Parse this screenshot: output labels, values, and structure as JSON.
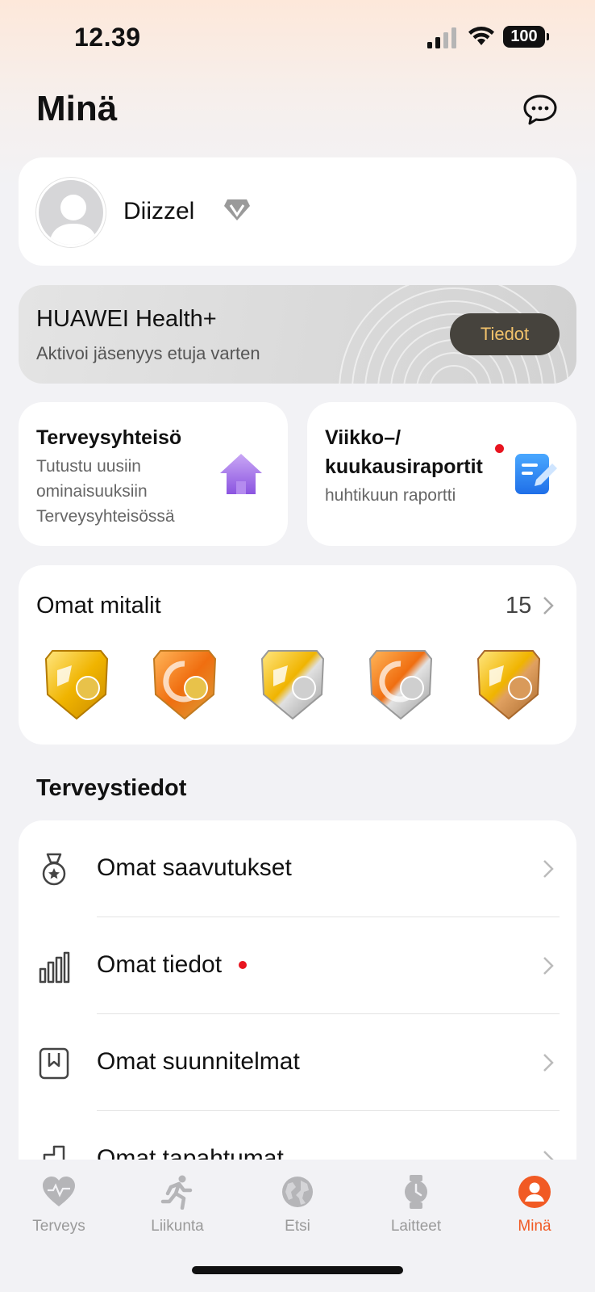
{
  "status_bar": {
    "time": "12.39",
    "battery": "100"
  },
  "header": {
    "title": "Minä"
  },
  "profile": {
    "name": "Diizzel"
  },
  "health_plus": {
    "title": "HUAWEI Health+",
    "subtitle": "Aktivoi jäsenyys etuja varten",
    "button": "Tiedot"
  },
  "tiles": [
    {
      "title": "Terveysyhteisö",
      "desc": [
        "Tutustu uusiin",
        "ominaisuuksiin",
        "Terveysyhteisössä"
      ]
    },
    {
      "title": [
        "Viikko–/",
        "kuukausiraportit"
      ],
      "desc": "huhtikuun raportti"
    }
  ],
  "medals": {
    "title": "Omat mitalit",
    "count": "15"
  },
  "health_info": {
    "title": "Terveystiedot",
    "items": [
      {
        "label": "Omat saavutukset",
        "icon": "medal-icon"
      },
      {
        "label": "Omat tiedot",
        "icon": "bar-chart-icon",
        "badge": true
      },
      {
        "label": "Omat suunnitelmat",
        "icon": "bookmark-icon"
      },
      {
        "label": "Omat tapahtumat",
        "icon": "event-icon"
      }
    ]
  },
  "tab_bar": {
    "tabs": [
      {
        "label": "Terveys",
        "icon": "heart-icon"
      },
      {
        "label": "Liikunta",
        "icon": "running-icon"
      },
      {
        "label": "Etsi",
        "icon": "globe-icon"
      },
      {
        "label": "Laitteet",
        "icon": "watch-icon"
      },
      {
        "label": "Minä",
        "icon": "profile-icon",
        "active": true
      }
    ]
  },
  "colors": {
    "accent": "#f15a24",
    "button_bg": "#46433d",
    "button_text": "#f2c26b",
    "notification": "#e8141f"
  }
}
